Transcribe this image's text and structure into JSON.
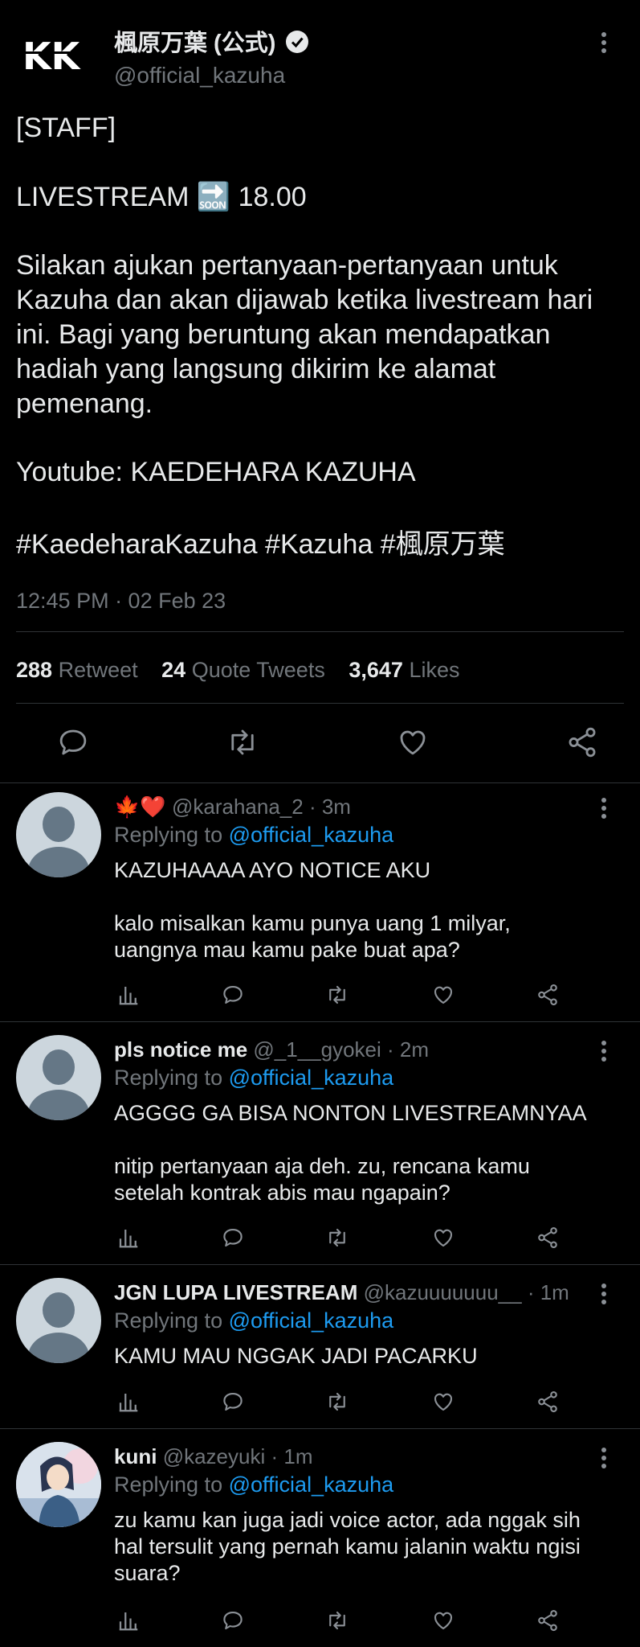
{
  "tweet": {
    "author_name": "楓原万葉 (公式)",
    "author_handle": "@official_kazuha",
    "logo_text": "KK",
    "lines": [
      "[STAFF]",
      "LIVESTREAM 🔜 18.00",
      "Silakan ajukan pertanyaan-pertanyaan untuk",
      "Kazuha dan akan dijawab ketika livestream hari",
      "ini. Bagi yang beruntung akan mendapatkan",
      "hadiah yang langsung dikirim ke alamat",
      "pemenang.",
      "Youtube: KAEDEHARA KAZUHA"
    ],
    "hashtags": [
      "#KaedeharaKazuha",
      "#Kazuha",
      "#楓原万葉"
    ],
    "timestamp": "12:45 PM · 02 Feb 23",
    "stats": {
      "retweets": "288",
      "retweets_label": "Retweet",
      "quotes": "24",
      "quotes_label": "Quote Tweets",
      "likes": "3,647",
      "likes_label": "Likes"
    }
  },
  "replies": [
    {
      "name": "🍁❤️",
      "handle": "@karahana_2",
      "time": "· 3m",
      "replying_label": "Replying to",
      "replying_to": "@official_kazuha",
      "lines": [
        "KAZUHAAAA AYO NOTICE AKU",
        "",
        "kalo misalkan kamu punya uang 1 milyar,",
        "uangnya mau kamu pake buat apa?"
      ]
    },
    {
      "name": "pls notice me",
      "handle": "@_1__gyokei",
      "time": "· 2m",
      "replying_label": "Replying to",
      "replying_to": "@official_kazuha",
      "lines": [
        "AGGGG GA BISA NONTON LIVESTREAMNYAA",
        "",
        "nitip pertanyaan aja deh. zu, rencana kamu",
        "setelah kontrak abis mau ngapain?"
      ]
    },
    {
      "name": "JGN LUPA LIVESTREAM",
      "handle": "@kazuuuuuuu__",
      "time": "· 1m",
      "replying_label": "Replying to",
      "replying_to": "@official_kazuha",
      "lines": [
        "KAMU MAU NGGAK JADI PACARKU"
      ]
    },
    {
      "name": "kuni",
      "handle": "@kazeyuki",
      "time": "· 1m",
      "replying_label": "Replying to",
      "replying_to": "@official_kazuha",
      "lines": [
        "zu kamu kan juga jadi voice actor, ada nggak sih",
        "hal tersulit yang pernah kamu jalanin waktu ngisi",
        "suara?"
      ]
    }
  ],
  "colors": {
    "accent": "#1d9bf0",
    "muted": "#71767b",
    "background": "#000000",
    "text": "#e7e9ea"
  }
}
